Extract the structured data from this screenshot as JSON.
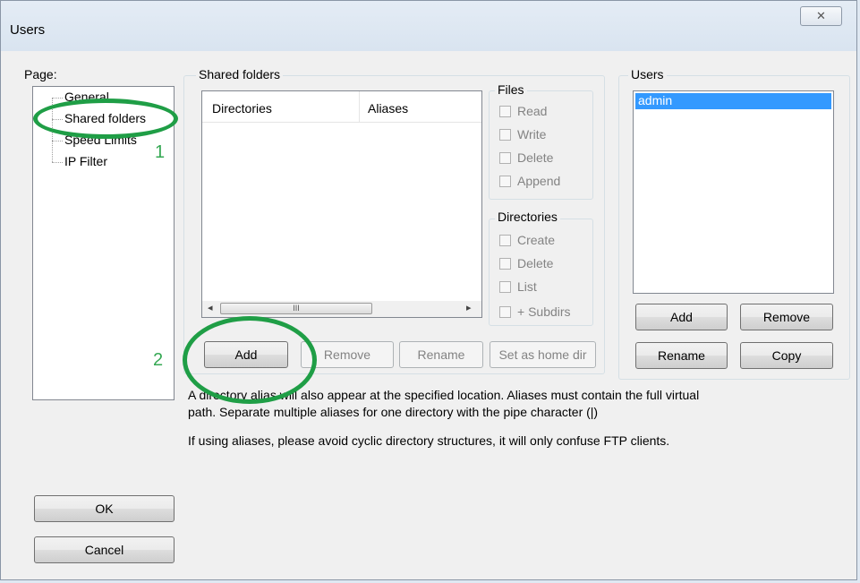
{
  "window": {
    "title": "Users",
    "close_glyph": "✕"
  },
  "page_tree": {
    "label": "Page:",
    "items": [
      {
        "label": "General"
      },
      {
        "label": "Shared folders"
      },
      {
        "label": "Speed Limits"
      },
      {
        "label": "IP Filter"
      }
    ]
  },
  "shared_folders": {
    "group_label": "Shared folders",
    "columns": [
      "Directories",
      "Aliases"
    ],
    "scroll_thumb_glyph": "III",
    "buttons": {
      "add": "Add",
      "remove": "Remove",
      "rename": "Rename",
      "set_home": "Set as home dir"
    }
  },
  "files": {
    "label": "Files",
    "options": [
      "Read",
      "Write",
      "Delete",
      "Append"
    ]
  },
  "directories": {
    "label": "Directories",
    "options": [
      "Create",
      "Delete",
      "List",
      "+ Subdirs"
    ]
  },
  "users": {
    "group_label": "Users",
    "list": [
      "admin"
    ],
    "buttons": {
      "add": "Add",
      "remove": "Remove",
      "rename": "Rename",
      "copy": "Copy"
    }
  },
  "info": {
    "line1": "A directory alias will also appear at the specified location. Aliases must contain the full virtual",
    "line2": "path. Separate multiple aliases for one directory with the pipe character (|)",
    "line3": "If using aliases, please avoid cyclic directory structures, it will only confuse FTP clients."
  },
  "dialog_buttons": {
    "ok": "OK",
    "cancel": "Cancel"
  },
  "annotations": {
    "one": "1",
    "two": "2",
    "color": "#1f9e46"
  }
}
